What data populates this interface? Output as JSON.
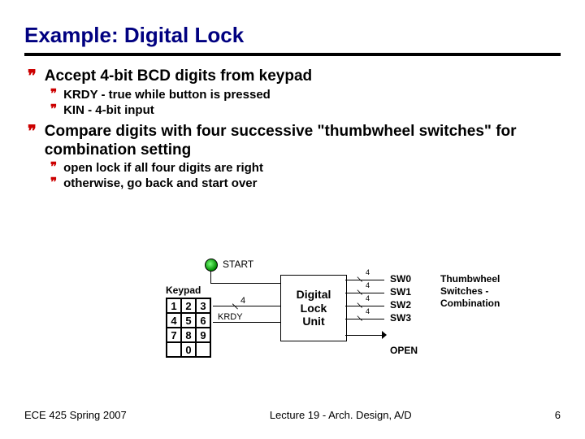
{
  "title": "Example: Digital Lock",
  "bullets": {
    "b1": "Accept 4-bit BCD digits from keypad",
    "b1a": "KRDY - true while button is pressed",
    "b1b": "KIN - 4-bit input",
    "b2": "Compare digits with four successive \"thumbwheel switches\" for combination setting",
    "b2a": "open lock if all four digits are right",
    "b2b": "otherwise, go back and start over"
  },
  "diagram": {
    "start": "START",
    "keypad_label": "Keypad",
    "keys": [
      "1",
      "2",
      "3",
      "4",
      "5",
      "6",
      "7",
      "8",
      "9",
      "",
      "0",
      ""
    ],
    "bus4": "4",
    "krdy": "KRDY",
    "unit": "Digital\nLock\nUnit",
    "sw": [
      "SW0",
      "SW1",
      "SW2",
      "SW3"
    ],
    "sw_width": "4",
    "thumb": "Thumbwheel\nSwitches -\nCombination",
    "open": "OPEN"
  },
  "footer": {
    "left": "ECE 425 Spring 2007",
    "center": "Lecture 19 - Arch. Design, A/D",
    "right": "6"
  }
}
